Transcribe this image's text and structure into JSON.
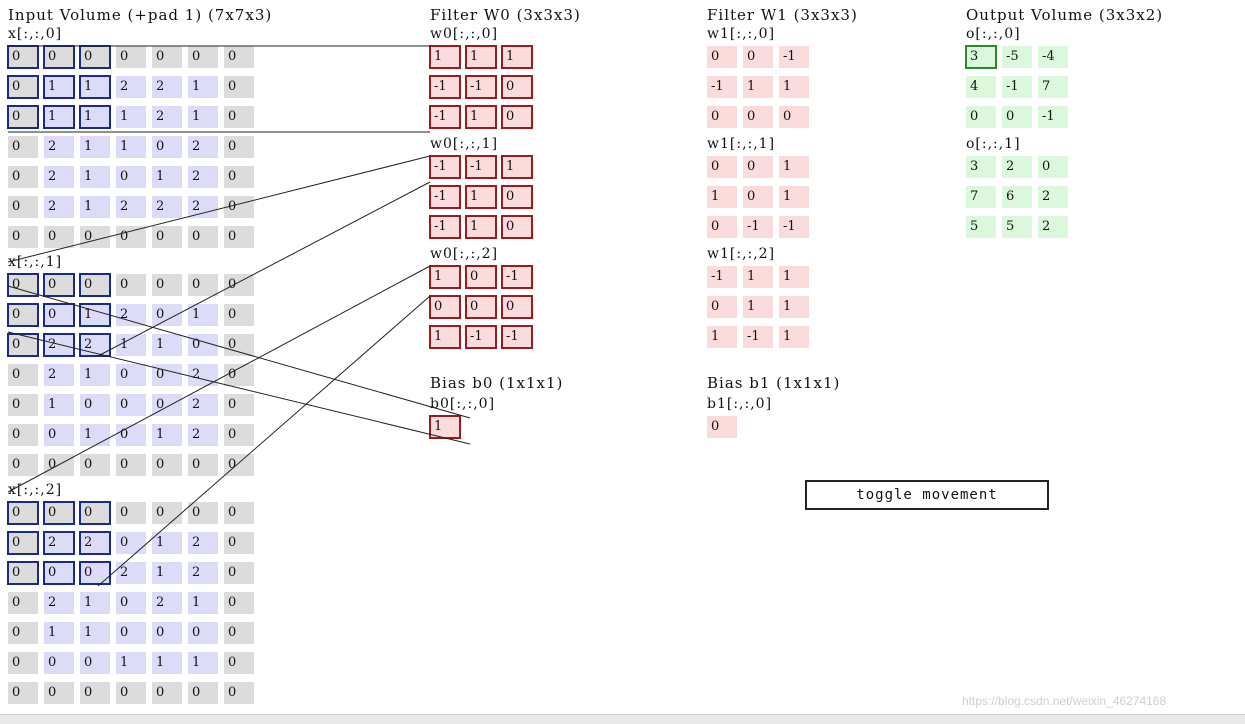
{
  "input": {
    "title": "Input Volume (+pad 1) (7x7x3)",
    "slices": [
      {
        "label": "x[:,:,0]",
        "rows": [
          [
            "0",
            "0",
            "0",
            "0",
            "0",
            "0",
            "0"
          ],
          [
            "0",
            "1",
            "1",
            "2",
            "2",
            "1",
            "0"
          ],
          [
            "0",
            "1",
            "1",
            "1",
            "2",
            "1",
            "0"
          ],
          [
            "0",
            "2",
            "1",
            "1",
            "0",
            "2",
            "0"
          ],
          [
            "0",
            "2",
            "1",
            "0",
            "1",
            "2",
            "0"
          ],
          [
            "0",
            "2",
            "1",
            "2",
            "2",
            "2",
            "0"
          ],
          [
            "0",
            "0",
            "0",
            "0",
            "0",
            "0",
            "0"
          ]
        ]
      },
      {
        "label": "x[:,:,1]",
        "rows": [
          [
            "0",
            "0",
            "0",
            "0",
            "0",
            "0",
            "0"
          ],
          [
            "0",
            "0",
            "1",
            "2",
            "0",
            "1",
            "0"
          ],
          [
            "0",
            "2",
            "2",
            "1",
            "1",
            "0",
            "0"
          ],
          [
            "0",
            "2",
            "1",
            "0",
            "0",
            "2",
            "0"
          ],
          [
            "0",
            "1",
            "0",
            "0",
            "0",
            "2",
            "0"
          ],
          [
            "0",
            "0",
            "1",
            "0",
            "1",
            "2",
            "0"
          ],
          [
            "0",
            "0",
            "0",
            "0",
            "0",
            "0",
            "0"
          ]
        ]
      },
      {
        "label": "x[:,:,2]",
        "rows": [
          [
            "0",
            "0",
            "0",
            "0",
            "0",
            "0",
            "0"
          ],
          [
            "0",
            "2",
            "2",
            "0",
            "1",
            "2",
            "0"
          ],
          [
            "0",
            "0",
            "0",
            "2",
            "1",
            "2",
            "0"
          ],
          [
            "0",
            "2",
            "1",
            "0",
            "2",
            "1",
            "0"
          ],
          [
            "0",
            "1",
            "1",
            "0",
            "0",
            "0",
            "0"
          ],
          [
            "0",
            "0",
            "0",
            "1",
            "1",
            "1",
            "0"
          ],
          [
            "0",
            "0",
            "0",
            "0",
            "0",
            "0",
            "0"
          ]
        ]
      }
    ]
  },
  "filter0": {
    "title": "Filter W0 (3x3x3)",
    "slices": [
      {
        "label": "w0[:,:,0]",
        "rows": [
          [
            "1",
            "1",
            "1"
          ],
          [
            "-1",
            "-1",
            "0"
          ],
          [
            "-1",
            "1",
            "0"
          ]
        ]
      },
      {
        "label": "w0[:,:,1]",
        "rows": [
          [
            "-1",
            "-1",
            "1"
          ],
          [
            "-1",
            "1",
            "0"
          ],
          [
            "-1",
            "1",
            "0"
          ]
        ]
      },
      {
        "label": "w0[:,:,2]",
        "rows": [
          [
            "1",
            "0",
            "-1"
          ],
          [
            "0",
            "0",
            "0"
          ],
          [
            "1",
            "-1",
            "-1"
          ]
        ]
      }
    ],
    "bias_title": "Bias b0 (1x1x1)",
    "bias_label": "b0[:,:,0]",
    "bias_value": "1"
  },
  "filter1": {
    "title": "Filter W1 (3x3x3)",
    "slices": [
      {
        "label": "w1[:,:,0]",
        "rows": [
          [
            "0",
            "0",
            "-1"
          ],
          [
            "-1",
            "1",
            "1"
          ],
          [
            "0",
            "0",
            "0"
          ]
        ]
      },
      {
        "label": "w1[:,:,1]",
        "rows": [
          [
            "0",
            "0",
            "1"
          ],
          [
            "1",
            "0",
            "1"
          ],
          [
            "0",
            "-1",
            "-1"
          ]
        ]
      },
      {
        "label": "w1[:,:,2]",
        "rows": [
          [
            "-1",
            "1",
            "1"
          ],
          [
            "0",
            "1",
            "1"
          ],
          [
            "1",
            "-1",
            "1"
          ]
        ]
      }
    ],
    "bias_title": "Bias b1 (1x1x1)",
    "bias_label": "b1[:,:,0]",
    "bias_value": "0"
  },
  "output": {
    "title": "Output Volume (3x3x2)",
    "slices": [
      {
        "label": "o[:,:,0]",
        "rows": [
          [
            "3",
            "-5",
            "-4"
          ],
          [
            "4",
            "-1",
            "7"
          ],
          [
            "0",
            "0",
            "-1"
          ]
        ]
      },
      {
        "label": "o[:,:,1]",
        "rows": [
          [
            "3",
            "2",
            "0"
          ],
          [
            "7",
            "6",
            "2"
          ],
          [
            "5",
            "5",
            "2"
          ]
        ]
      }
    ]
  },
  "toggle_button": "toggle movement",
  "watermark": "https://blog.csdn.net/weixin_46274168",
  "colors": {
    "pad": "#dcdcdc",
    "input": "#dcdcf8",
    "filter": "#fadcdc",
    "output": "#dcf8dc",
    "input_highlight": "#1a2a8a",
    "filter_highlight": "#9b1c1c",
    "output_highlight": "#2a8a2a"
  }
}
